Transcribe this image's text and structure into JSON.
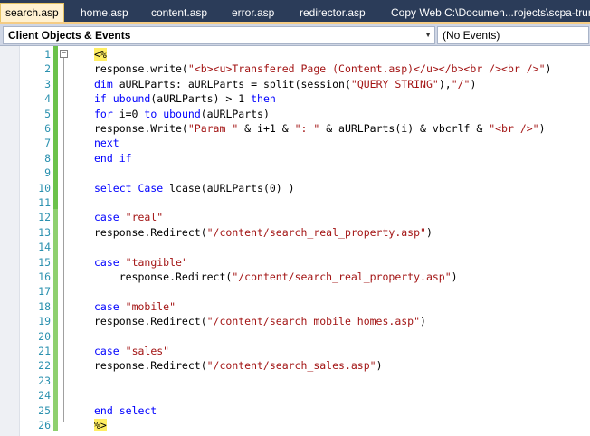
{
  "tabs": [
    {
      "label": "search.asp",
      "active": true
    },
    {
      "label": "home.asp",
      "active": false
    },
    {
      "label": "content.asp",
      "active": false
    },
    {
      "label": "error.asp",
      "active": false
    },
    {
      "label": "redirector.asp",
      "active": false
    },
    {
      "label": "Copy Web C:\\Documen...rojects\\scpa-trunk\\",
      "active": false
    }
  ],
  "dropdowns": {
    "objects": "Client Objects & Events",
    "events": "(No Events)"
  },
  "colors": {
    "keyword": "#0000ff",
    "string": "#a31515",
    "line_number": "#2b91af",
    "change_bar": "#6cc24a",
    "delimiter_highlight": "#ffee62"
  },
  "code_lines": [
    {
      "num": "1",
      "segments": [
        {
          "t": "<%",
          "c": "hl"
        }
      ]
    },
    {
      "num": "2",
      "segments": [
        {
          "t": "response.write("
        },
        {
          "t": "\"<b><u>Transfered Page (Content.asp)</u></b><br /><br />\"",
          "c": "str"
        },
        {
          "t": ")"
        }
      ]
    },
    {
      "num": "3",
      "segments": [
        {
          "t": "dim",
          "c": "kw"
        },
        {
          "t": " aURLParts: aURLParts = split(session("
        },
        {
          "t": "\"QUERY_STRING\"",
          "c": "str"
        },
        {
          "t": "),"
        },
        {
          "t": "\"/\"",
          "c": "str"
        },
        {
          "t": ")"
        }
      ]
    },
    {
      "num": "4",
      "segments": [
        {
          "t": "if",
          "c": "kw"
        },
        {
          "t": " "
        },
        {
          "t": "ubound",
          "c": "kw"
        },
        {
          "t": "(aURLParts) > 1 "
        },
        {
          "t": "then",
          "c": "kw"
        }
      ]
    },
    {
      "num": "5",
      "segments": [
        {
          "t": "for",
          "c": "kw"
        },
        {
          "t": " i=0 "
        },
        {
          "t": "to",
          "c": "kw"
        },
        {
          "t": " "
        },
        {
          "t": "ubound",
          "c": "kw"
        },
        {
          "t": "(aURLParts)"
        }
      ]
    },
    {
      "num": "6",
      "segments": [
        {
          "t": "response.Write("
        },
        {
          "t": "\"Param \"",
          "c": "str"
        },
        {
          "t": " & i+1 & "
        },
        {
          "t": "\": \"",
          "c": "str"
        },
        {
          "t": " & aURLParts(i) & vbcrlf & "
        },
        {
          "t": "\"<br />\"",
          "c": "str"
        },
        {
          "t": ")"
        }
      ]
    },
    {
      "num": "7",
      "segments": [
        {
          "t": "next",
          "c": "kw"
        }
      ]
    },
    {
      "num": "8",
      "segments": [
        {
          "t": "end if",
          "c": "kw"
        }
      ]
    },
    {
      "num": "9",
      "segments": []
    },
    {
      "num": "10",
      "segments": [
        {
          "t": "select Case",
          "c": "kw"
        },
        {
          "t": " lcase(aURLParts(0) )"
        }
      ]
    },
    {
      "num": "11",
      "segments": []
    },
    {
      "num": "12",
      "segments": [
        {
          "t": "case",
          "c": "kw"
        },
        {
          "t": " "
        },
        {
          "t": "\"real\"",
          "c": "str"
        }
      ]
    },
    {
      "num": "13",
      "segments": [
        {
          "t": "response.Redirect("
        },
        {
          "t": "\"/content/search_real_property.asp\"",
          "c": "str"
        },
        {
          "t": ")"
        }
      ]
    },
    {
      "num": "14",
      "segments": []
    },
    {
      "num": "15",
      "segments": [
        {
          "t": "case",
          "c": "kw"
        },
        {
          "t": " "
        },
        {
          "t": "\"tangible\"",
          "c": "str"
        }
      ]
    },
    {
      "num": "16",
      "segments": [
        {
          "t": "    response.Redirect("
        },
        {
          "t": "\"/content/search_real_property.asp\"",
          "c": "str"
        },
        {
          "t": ")"
        }
      ]
    },
    {
      "num": "17",
      "segments": []
    },
    {
      "num": "18",
      "segments": [
        {
          "t": "case",
          "c": "kw"
        },
        {
          "t": " "
        },
        {
          "t": "\"mobile\"",
          "c": "str"
        }
      ]
    },
    {
      "num": "19",
      "segments": [
        {
          "t": "response.Redirect("
        },
        {
          "t": "\"/content/search_mobile_homes.asp\"",
          "c": "str"
        },
        {
          "t": ")"
        }
      ]
    },
    {
      "num": "20",
      "segments": []
    },
    {
      "num": "21",
      "segments": [
        {
          "t": "case",
          "c": "kw"
        },
        {
          "t": " "
        },
        {
          "t": "\"sales\"",
          "c": "str"
        }
      ]
    },
    {
      "num": "22",
      "segments": [
        {
          "t": "response.Redirect("
        },
        {
          "t": "\"/content/search_sales.asp\"",
          "c": "str"
        },
        {
          "t": ")"
        }
      ]
    },
    {
      "num": "23",
      "segments": []
    },
    {
      "num": "24",
      "segments": []
    },
    {
      "num": "25",
      "segments": [
        {
          "t": "end select",
          "c": "kw"
        }
      ]
    },
    {
      "num": "26",
      "segments": [
        {
          "t": "%>",
          "c": "hl"
        }
      ]
    }
  ]
}
